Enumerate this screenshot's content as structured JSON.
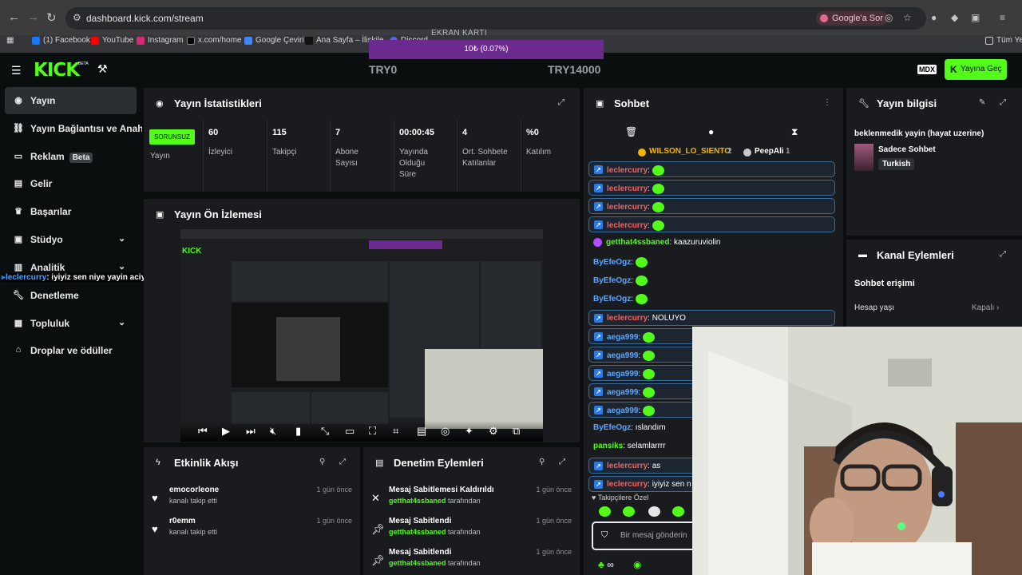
{
  "browser": {
    "url": "dashboard.kick.com/stream",
    "ask_google": "Google'a Sor",
    "bookmarks": [
      {
        "label": "(1) Facebook",
        "icon": "facebook-icon"
      },
      {
        "label": "YouTube",
        "icon": "youtube-icon"
      },
      {
        "label": "Instagram",
        "icon": "instagram-icon"
      },
      {
        "label": "x.com/home",
        "icon": "x-icon"
      },
      {
        "label": "Google Çeviri",
        "icon": "translate-icon"
      },
      {
        "label": "Ana Sayfa – İlişkile...",
        "icon": "page-icon"
      },
      {
        "label": "Discord",
        "icon": "discord-icon"
      }
    ],
    "all_bookmarks": "Tüm Yer"
  },
  "overlay": {
    "gpu_label": "EKRAN KARTI",
    "gpu_progress_text": "10₺ (0.07%)",
    "gpu_progress_fraction": 0.0007,
    "try_min": "TRY0",
    "try_max": "TRY14000",
    "chat_user": "leclercurry",
    "chat_text": ": iyiyiz sen niye yayin aciyon"
  },
  "app": {
    "logo": "KICK",
    "logo_badge": "BETA",
    "mdx": "MDX",
    "go_live": "Yayına Geç"
  },
  "sidebar": {
    "items": [
      {
        "label": "Yayın",
        "icon": "broadcast-icon",
        "active": true,
        "chevron": false
      },
      {
        "label": "Yayın Bağlantısı ve Anahtarı",
        "icon": "link-icon",
        "active": false,
        "chevron": false
      },
      {
        "label": "Reklam",
        "badge": "Beta",
        "icon": "ad-icon",
        "active": false,
        "chevron": false
      },
      {
        "label": "Gelir",
        "icon": "revenue-icon",
        "active": false,
        "chevron": false
      },
      {
        "label": "Başarılar",
        "icon": "trophy-icon",
        "active": false,
        "chevron": false
      },
      {
        "label": "Stüdyo",
        "icon": "studio-icon",
        "active": false,
        "chevron": true
      },
      {
        "label": "Analitik",
        "icon": "analytics-icon",
        "active": false,
        "chevron": true
      },
      {
        "label": "Denetleme",
        "icon": "wrench-icon",
        "active": false,
        "chevron": false
      },
      {
        "label": "Topluluk",
        "icon": "community-icon",
        "active": false,
        "chevron": true
      },
      {
        "label": "Droplar ve ödüller",
        "icon": "gift-icon",
        "active": false,
        "chevron": false
      }
    ]
  },
  "stats": {
    "title": "Yayın İstatistikleri",
    "status": "SORUNSUZ",
    "status_label": "Yayın",
    "items": [
      {
        "value": "60",
        "label": "İzleyici"
      },
      {
        "value": "115",
        "label": "Takipçi"
      },
      {
        "value": "7",
        "label": "Abone Sayısı"
      },
      {
        "value": "00:00:45",
        "label": "Yayında Olduğu Süre"
      },
      {
        "value": "4",
        "label": "Ort. Sohbete Katılanlar"
      },
      {
        "value": "%0",
        "label": "Katılım"
      }
    ]
  },
  "preview": {
    "title": "Yayın Ön İzlemesi"
  },
  "feed": {
    "title": "Etkinlik Akışı",
    "events": [
      {
        "user": "emocorleone",
        "action": "kanalı takip etti",
        "time": "1 gün önce"
      },
      {
        "user": "r0emm",
        "action": "kanalı takip etti",
        "time": "1 gün önce"
      }
    ]
  },
  "moderation": {
    "title": "Denetim Eylemleri",
    "events": [
      {
        "action": "Mesaj Sabitlemesi Kaldırıldı",
        "user": "getthat4ssbaned",
        "suffix": "tarafından",
        "time": "1 gün önce",
        "icon": "unpin-icon"
      },
      {
        "action": "Mesaj Sabitlendi",
        "user": "getthat4ssbaned",
        "suffix": "tarafından",
        "time": "1 gün önce",
        "icon": "pin-icon"
      },
      {
        "action": "Mesaj Sabitlendi",
        "user": "getthat4ssbaned",
        "suffix": "tarafından",
        "time": "1 gün önce",
        "icon": "pin-icon"
      }
    ]
  },
  "chat": {
    "title": "Sohbet",
    "pinned": [
      {
        "user": "WILSON_LO_SIENTO",
        "count": "2"
      },
      {
        "user": "PeepAli",
        "count": "1"
      }
    ],
    "messages": [
      {
        "user": "leclercurry",
        "text": ":",
        "emote": true,
        "style": "mod"
      },
      {
        "user": "leclercurry",
        "text": ":",
        "emote": true,
        "style": "mod"
      },
      {
        "user": "leclercurry",
        "text": ":",
        "emote": true,
        "style": "mod"
      },
      {
        "user": "leclercurry",
        "text": ":",
        "emote": true,
        "style": "mod"
      },
      {
        "user": "getthat4ssbaned",
        "text": ": kaazuruviolin",
        "emote": false,
        "style": "sub"
      },
      {
        "user": "ByEfeOgz",
        "text": ":",
        "emote": true,
        "style": "plain"
      },
      {
        "user": "ByEfeOgz",
        "text": ":",
        "emote": true,
        "style": "plain"
      },
      {
        "user": "ByEfeOgz",
        "text": ":",
        "emote": true,
        "style": "plain"
      },
      {
        "user": "leclercurry",
        "text": ": NOLUYO",
        "emote": false,
        "style": "mod"
      },
      {
        "user": "aega999",
        "text": ":",
        "emote": true,
        "style": "mod"
      },
      {
        "user": "aega999",
        "text": ":",
        "emote": true,
        "style": "mod"
      },
      {
        "user": "aega999",
        "text": ":",
        "emote": true,
        "style": "mod"
      },
      {
        "user": "aega999",
        "text": ":",
        "emote": true,
        "style": "mod"
      },
      {
        "user": "aega999",
        "text": ":",
        "emote": true,
        "style": "mod"
      },
      {
        "user": "ByEfeOgz",
        "text": ": ıslandım",
        "emote": false,
        "style": "plain"
      },
      {
        "user": "pansiks",
        "text": ": selamlarrrr",
        "emote": false,
        "style": "plain"
      },
      {
        "user": "leclercurry",
        "text": ": as",
        "emote": false,
        "style": "mod"
      },
      {
        "user": "leclercurry",
        "text": ": iyiyiz sen n",
        "emote": false,
        "style": "mod"
      }
    ],
    "followers_only": "Takipçilere Özel",
    "placeholder": "Bir mesaj gönderin",
    "footer_infinity": "∞"
  },
  "stream_info": {
    "title": "Yayın bilgisi",
    "stream_title": "beklenmedik yayin (hayat uzerine)",
    "category": "Sadece Sohbet",
    "language": "Turkish"
  },
  "channel_actions": {
    "title": "Kanal Eylemleri",
    "chat_access": "Sohbet erişimi",
    "account_age_label": "Hesap yaşı",
    "account_age_value": "Kapalı"
  },
  "colors": {
    "brand": "#53fc18",
    "panel": "#191b1f",
    "background": "#0b0e0f",
    "mod_user": "#ff5f5f",
    "vip_user": "#5ea7ff"
  }
}
